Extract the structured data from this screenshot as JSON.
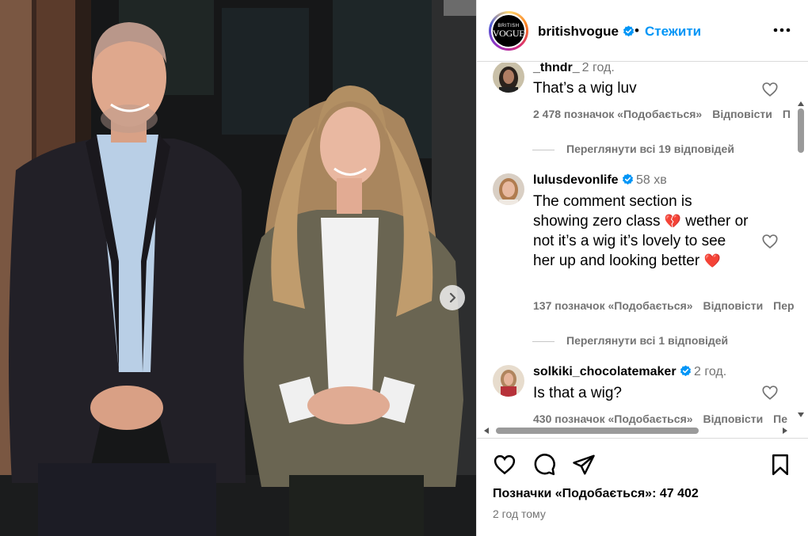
{
  "post": {
    "image_alt": "Photo of a man in a dark blazer and a woman in a tweed jacket standing outdoors",
    "carousel_next_icon": "chevron-right-icon"
  },
  "header": {
    "username": "britishvogue",
    "verified": true,
    "separator": "•",
    "follow_label": "Стежити",
    "logo_line1": "BRITISH",
    "logo_line2": "VOGUE"
  },
  "comments": [
    {
      "username": "_thndr_",
      "verified": false,
      "time": "2 год.",
      "text": "That’s a wig luv",
      "likes": "2 478 позначок «Подобається»",
      "reply_label": "Відповісти",
      "more_label": "П",
      "replies_label": "Переглянути всі 19 відповідей"
    },
    {
      "username": "lulusdevonlife",
      "verified": true,
      "time": "58 хв",
      "text_parts": [
        "The comment section is showing zero class",
        "wether or not it’s a wig it’s lovely to see her up and looking better"
      ],
      "emoji1": "💔",
      "emoji2": "❤️",
      "likes": "137 позначок «Подобається»",
      "reply_label": "Відповісти",
      "more_label": "Пер",
      "replies_label": "Переглянути всі 1 відповідей"
    },
    {
      "username": "solkiki_chocolatemaker",
      "verified": true,
      "time": "2 год.",
      "text": "Is that a wig?",
      "likes": "430 позначок «Подобається»",
      "reply_label": "Відповісти",
      "more_label": "Пе"
    }
  ],
  "footer": {
    "likes_text": "Позначки «Подобається»: 47 402",
    "posted_ago": "2 год тому"
  },
  "colors": {
    "link_blue": "#0095f6",
    "muted_gray": "#737373",
    "border": "#dbdbdb"
  }
}
